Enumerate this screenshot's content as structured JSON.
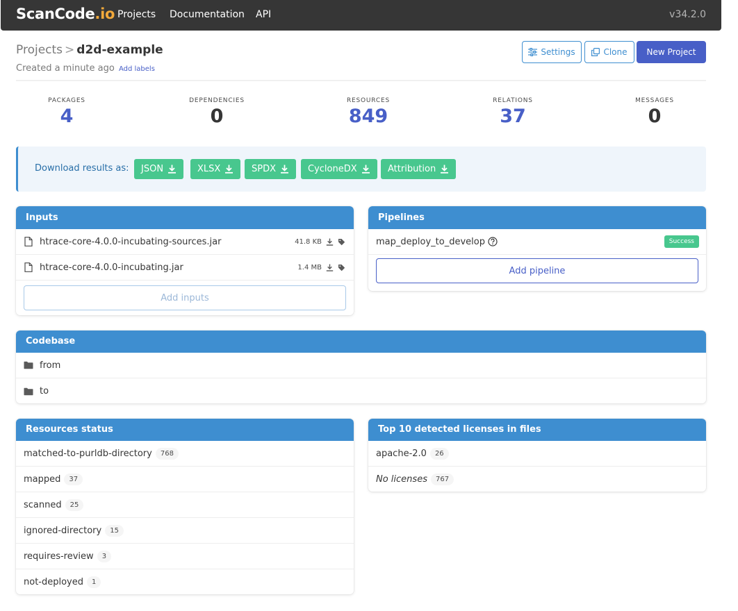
{
  "nav": {
    "brand_main": "ScanCode",
    "brand_dot": ".io",
    "links": [
      "Projects",
      "Documentation",
      "API"
    ],
    "version": "v34.2.0"
  },
  "header": {
    "breadcrumb_root": "Projects",
    "breadcrumb_sep": ">",
    "project_name": "d2d-example",
    "created": "Created a minute ago",
    "add_labels": "Add labels",
    "settings_label": "Settings",
    "clone_label": "Clone",
    "new_project_label": "New Project"
  },
  "stats": [
    {
      "label": "PACKAGES",
      "value": "4"
    },
    {
      "label": "DEPENDENCIES",
      "value": "0"
    },
    {
      "label": "RESOURCES",
      "value": "849"
    },
    {
      "label": "RELATIONS",
      "value": "37"
    },
    {
      "label": "MESSAGES",
      "value": "0"
    }
  ],
  "download": {
    "label": "Download results as:",
    "formats": [
      "JSON",
      "XLSX",
      "SPDX",
      "CycloneDX",
      "Attribution"
    ]
  },
  "inputs": {
    "title": "Inputs",
    "files": [
      {
        "name": "htrace-core-4.0.0-incubating-sources.jar",
        "size": "41.8 KB"
      },
      {
        "name": "htrace-core-4.0.0-incubating.jar",
        "size": "1.4 MB"
      }
    ],
    "add_label": "Add inputs"
  },
  "pipelines": {
    "title": "Pipelines",
    "items": [
      {
        "name": "map_deploy_to_develop",
        "status": "Success"
      }
    ],
    "add_label": "Add pipeline"
  },
  "codebase": {
    "title": "Codebase",
    "dirs": [
      "from",
      "to"
    ]
  },
  "resources_status": {
    "title": "Resources status",
    "items": [
      {
        "label": "matched-to-purldb-directory",
        "count": "768"
      },
      {
        "label": "mapped",
        "count": "37"
      },
      {
        "label": "scanned",
        "count": "25"
      },
      {
        "label": "ignored-directory",
        "count": "15"
      },
      {
        "label": "requires-review",
        "count": "3"
      },
      {
        "label": "not-deployed",
        "count": "1"
      }
    ]
  },
  "licenses": {
    "title": "Top 10 detected licenses in files",
    "items": [
      {
        "label": "apache-2.0",
        "count": "26"
      },
      {
        "label": "No licenses",
        "count": "767"
      }
    ]
  },
  "colors": {
    "navbar": "#363636",
    "link": "#485fc7",
    "info": "#3e8ed0",
    "success": "#48c78e"
  }
}
